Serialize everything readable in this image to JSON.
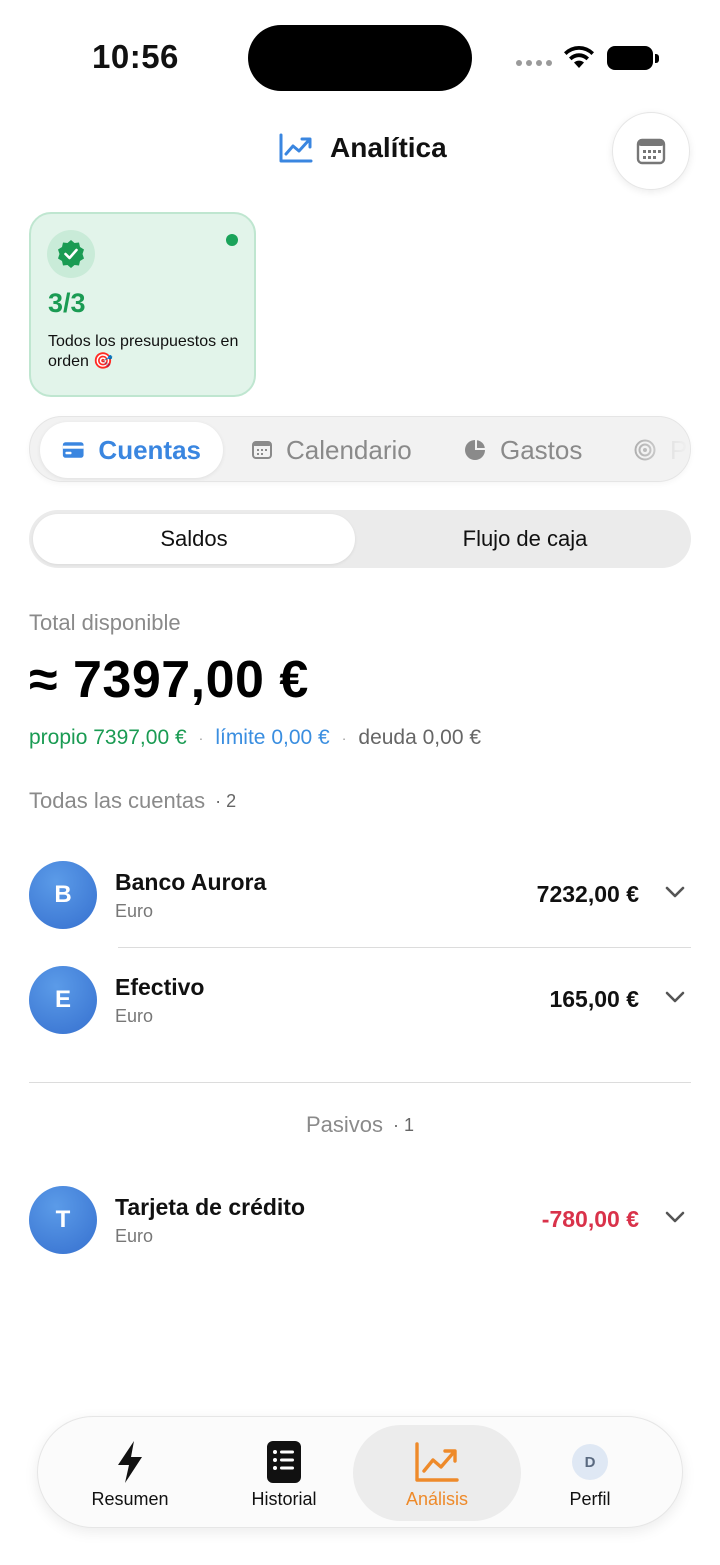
{
  "status_bar": {
    "time": "10:56"
  },
  "header": {
    "title": "Analítica",
    "title_icon": "trend-chart-icon",
    "calendar_icon": "calendar-icon"
  },
  "budget_card": {
    "count": "3/3",
    "text": "Todos los presupuestos en orden 🎯",
    "icon": "verified-check-icon",
    "status_color": "#1aa35a"
  },
  "tabs": [
    {
      "label": "Cuentas",
      "icon": "card-icon",
      "active": true
    },
    {
      "label": "Calendario",
      "icon": "calendar-icon",
      "active": false
    },
    {
      "label": "Gastos",
      "icon": "pie-chart-icon",
      "active": false
    },
    {
      "label": "P",
      "icon": "target-icon",
      "active": false
    }
  ],
  "segment": {
    "options": [
      "Saldos",
      "Flujo de caja"
    ],
    "selected": "Saldos"
  },
  "summary": {
    "total_label": "Total disponible",
    "total_value": "≈ 7397,00 €",
    "own": "propio 7397,00 €",
    "limit": "límite 0,00 €",
    "debt": "deuda 0,00 €",
    "separator": "·"
  },
  "accounts_section": {
    "title": "Todas las cuentas",
    "count": "· 2",
    "items": [
      {
        "initial": "B",
        "name": "Banco Aurora",
        "currency": "Euro",
        "amount": "7232,00 €"
      },
      {
        "initial": "E",
        "name": "Efectivo",
        "currency": "Euro",
        "amount": "165,00 €"
      }
    ]
  },
  "liabilities_section": {
    "title": "Pasivos",
    "count": "· 1",
    "items": [
      {
        "initial": "T",
        "name": "Tarjeta de crédito",
        "currency": "Euro",
        "amount": "-780,00 €"
      }
    ]
  },
  "tabbar": [
    {
      "label": "Resumen",
      "icon": "lightning-icon",
      "active": false
    },
    {
      "label": "Historial",
      "icon": "list-icon",
      "active": false
    },
    {
      "label": "Análisis",
      "icon": "trend-chart-icon",
      "active": true
    },
    {
      "label": "Perfil",
      "icon": "avatar-icon",
      "initial": "D",
      "active": false
    }
  ],
  "colors": {
    "accent_blue": "#3a86e0",
    "positive_green": "#1a9b53",
    "negative_red": "#d9324a",
    "active_orange": "#ee8a2a"
  }
}
